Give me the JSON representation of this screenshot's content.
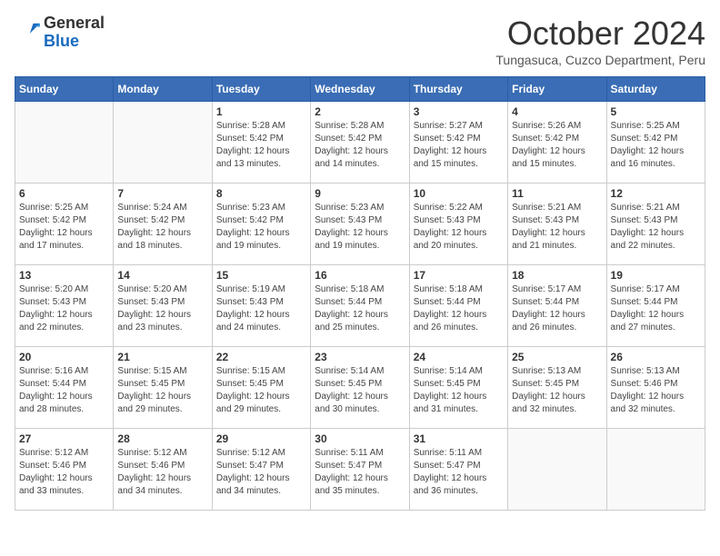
{
  "logo": {
    "general": "General",
    "blue": "Blue"
  },
  "title": "October 2024",
  "subtitle": "Tungasuca, Cuzco Department, Peru",
  "weekdays": [
    "Sunday",
    "Monday",
    "Tuesday",
    "Wednesday",
    "Thursday",
    "Friday",
    "Saturday"
  ],
  "weeks": [
    [
      {
        "day": null
      },
      {
        "day": null
      },
      {
        "day": "1",
        "sunrise": "Sunrise: 5:28 AM",
        "sunset": "Sunset: 5:42 PM",
        "daylight": "Daylight: 12 hours and 13 minutes."
      },
      {
        "day": "2",
        "sunrise": "Sunrise: 5:28 AM",
        "sunset": "Sunset: 5:42 PM",
        "daylight": "Daylight: 12 hours and 14 minutes."
      },
      {
        "day": "3",
        "sunrise": "Sunrise: 5:27 AM",
        "sunset": "Sunset: 5:42 PM",
        "daylight": "Daylight: 12 hours and 15 minutes."
      },
      {
        "day": "4",
        "sunrise": "Sunrise: 5:26 AM",
        "sunset": "Sunset: 5:42 PM",
        "daylight": "Daylight: 12 hours and 15 minutes."
      },
      {
        "day": "5",
        "sunrise": "Sunrise: 5:25 AM",
        "sunset": "Sunset: 5:42 PM",
        "daylight": "Daylight: 12 hours and 16 minutes."
      }
    ],
    [
      {
        "day": "6",
        "sunrise": "Sunrise: 5:25 AM",
        "sunset": "Sunset: 5:42 PM",
        "daylight": "Daylight: 12 hours and 17 minutes."
      },
      {
        "day": "7",
        "sunrise": "Sunrise: 5:24 AM",
        "sunset": "Sunset: 5:42 PM",
        "daylight": "Daylight: 12 hours and 18 minutes."
      },
      {
        "day": "8",
        "sunrise": "Sunrise: 5:23 AM",
        "sunset": "Sunset: 5:42 PM",
        "daylight": "Daylight: 12 hours and 19 minutes."
      },
      {
        "day": "9",
        "sunrise": "Sunrise: 5:23 AM",
        "sunset": "Sunset: 5:43 PM",
        "daylight": "Daylight: 12 hours and 19 minutes."
      },
      {
        "day": "10",
        "sunrise": "Sunrise: 5:22 AM",
        "sunset": "Sunset: 5:43 PM",
        "daylight": "Daylight: 12 hours and 20 minutes."
      },
      {
        "day": "11",
        "sunrise": "Sunrise: 5:21 AM",
        "sunset": "Sunset: 5:43 PM",
        "daylight": "Daylight: 12 hours and 21 minutes."
      },
      {
        "day": "12",
        "sunrise": "Sunrise: 5:21 AM",
        "sunset": "Sunset: 5:43 PM",
        "daylight": "Daylight: 12 hours and 22 minutes."
      }
    ],
    [
      {
        "day": "13",
        "sunrise": "Sunrise: 5:20 AM",
        "sunset": "Sunset: 5:43 PM",
        "daylight": "Daylight: 12 hours and 22 minutes."
      },
      {
        "day": "14",
        "sunrise": "Sunrise: 5:20 AM",
        "sunset": "Sunset: 5:43 PM",
        "daylight": "Daylight: 12 hours and 23 minutes."
      },
      {
        "day": "15",
        "sunrise": "Sunrise: 5:19 AM",
        "sunset": "Sunset: 5:43 PM",
        "daylight": "Daylight: 12 hours and 24 minutes."
      },
      {
        "day": "16",
        "sunrise": "Sunrise: 5:18 AM",
        "sunset": "Sunset: 5:44 PM",
        "daylight": "Daylight: 12 hours and 25 minutes."
      },
      {
        "day": "17",
        "sunrise": "Sunrise: 5:18 AM",
        "sunset": "Sunset: 5:44 PM",
        "daylight": "Daylight: 12 hours and 26 minutes."
      },
      {
        "day": "18",
        "sunrise": "Sunrise: 5:17 AM",
        "sunset": "Sunset: 5:44 PM",
        "daylight": "Daylight: 12 hours and 26 minutes."
      },
      {
        "day": "19",
        "sunrise": "Sunrise: 5:17 AM",
        "sunset": "Sunset: 5:44 PM",
        "daylight": "Daylight: 12 hours and 27 minutes."
      }
    ],
    [
      {
        "day": "20",
        "sunrise": "Sunrise: 5:16 AM",
        "sunset": "Sunset: 5:44 PM",
        "daylight": "Daylight: 12 hours and 28 minutes."
      },
      {
        "day": "21",
        "sunrise": "Sunrise: 5:15 AM",
        "sunset": "Sunset: 5:45 PM",
        "daylight": "Daylight: 12 hours and 29 minutes."
      },
      {
        "day": "22",
        "sunrise": "Sunrise: 5:15 AM",
        "sunset": "Sunset: 5:45 PM",
        "daylight": "Daylight: 12 hours and 29 minutes."
      },
      {
        "day": "23",
        "sunrise": "Sunrise: 5:14 AM",
        "sunset": "Sunset: 5:45 PM",
        "daylight": "Daylight: 12 hours and 30 minutes."
      },
      {
        "day": "24",
        "sunrise": "Sunrise: 5:14 AM",
        "sunset": "Sunset: 5:45 PM",
        "daylight": "Daylight: 12 hours and 31 minutes."
      },
      {
        "day": "25",
        "sunrise": "Sunrise: 5:13 AM",
        "sunset": "Sunset: 5:45 PM",
        "daylight": "Daylight: 12 hours and 32 minutes."
      },
      {
        "day": "26",
        "sunrise": "Sunrise: 5:13 AM",
        "sunset": "Sunset: 5:46 PM",
        "daylight": "Daylight: 12 hours and 32 minutes."
      }
    ],
    [
      {
        "day": "27",
        "sunrise": "Sunrise: 5:12 AM",
        "sunset": "Sunset: 5:46 PM",
        "daylight": "Daylight: 12 hours and 33 minutes."
      },
      {
        "day": "28",
        "sunrise": "Sunrise: 5:12 AM",
        "sunset": "Sunset: 5:46 PM",
        "daylight": "Daylight: 12 hours and 34 minutes."
      },
      {
        "day": "29",
        "sunrise": "Sunrise: 5:12 AM",
        "sunset": "Sunset: 5:47 PM",
        "daylight": "Daylight: 12 hours and 34 minutes."
      },
      {
        "day": "30",
        "sunrise": "Sunrise: 5:11 AM",
        "sunset": "Sunset: 5:47 PM",
        "daylight": "Daylight: 12 hours and 35 minutes."
      },
      {
        "day": "31",
        "sunrise": "Sunrise: 5:11 AM",
        "sunset": "Sunset: 5:47 PM",
        "daylight": "Daylight: 12 hours and 36 minutes."
      },
      {
        "day": null
      },
      {
        "day": null
      }
    ]
  ]
}
